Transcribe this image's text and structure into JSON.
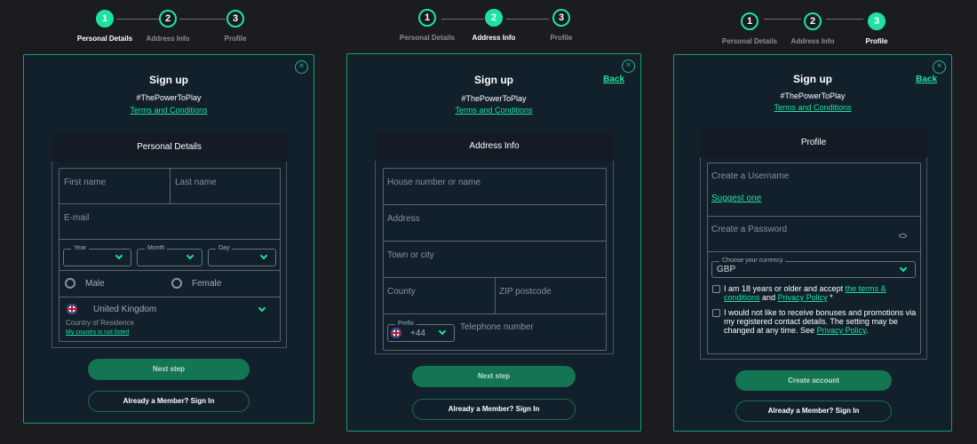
{
  "steps": [
    "Personal Details",
    "Address Info",
    "Profile"
  ],
  "step_numbers": [
    "1",
    "2",
    "3"
  ],
  "colors": {
    "accent": "#1ee3a0",
    "background": "#1b1c20",
    "card": "#12202c",
    "button": "#137552"
  },
  "common": {
    "title": "Sign up",
    "hashtag": "#ThePowerToPlay",
    "terms": "Terms and Conditions",
    "back": "Back",
    "close_icon": "×",
    "sign_in": "Already a Member? Sign In"
  },
  "panel1": {
    "active_step": 1,
    "section": "Personal Details",
    "first_name": "First name",
    "last_name": "Last name",
    "email": "E-mail",
    "year": "Year",
    "month": "Month",
    "day": "Day",
    "male": "Male",
    "female": "Female",
    "country": "United Kingdom",
    "country_label": "Country of Residence",
    "country_not_listed": "My country is not listed",
    "next": "Next step"
  },
  "panel2": {
    "active_step": 2,
    "section": "Address Info",
    "house": "House number or name",
    "address": "Address",
    "town": "Town or city",
    "county": "County",
    "zip": "ZIP postcode",
    "prefix_label": "Prefix",
    "prefix": "+44",
    "phone": "Telephone number",
    "next": "Next step"
  },
  "panel3": {
    "active_step": 3,
    "section": "Profile",
    "username": "Create a Username",
    "suggest": "Suggest one",
    "password": "Create a Password",
    "currency_label": "Choose your currency",
    "currency": "GBP",
    "age_text_1": "I am 18 years or older and accept ",
    "age_link_1": "the terms & conditions",
    "age_text_2": " and ",
    "age_link_2": "Privacy Policy",
    "age_text_3": " *",
    "bonus_text": "I would not like to receive bonuses and promotions via my registered contact details. The setting may be changed at any time. See ",
    "bonus_link": "Privacy Policy",
    "bonus_end": ".",
    "create": "Create account"
  }
}
